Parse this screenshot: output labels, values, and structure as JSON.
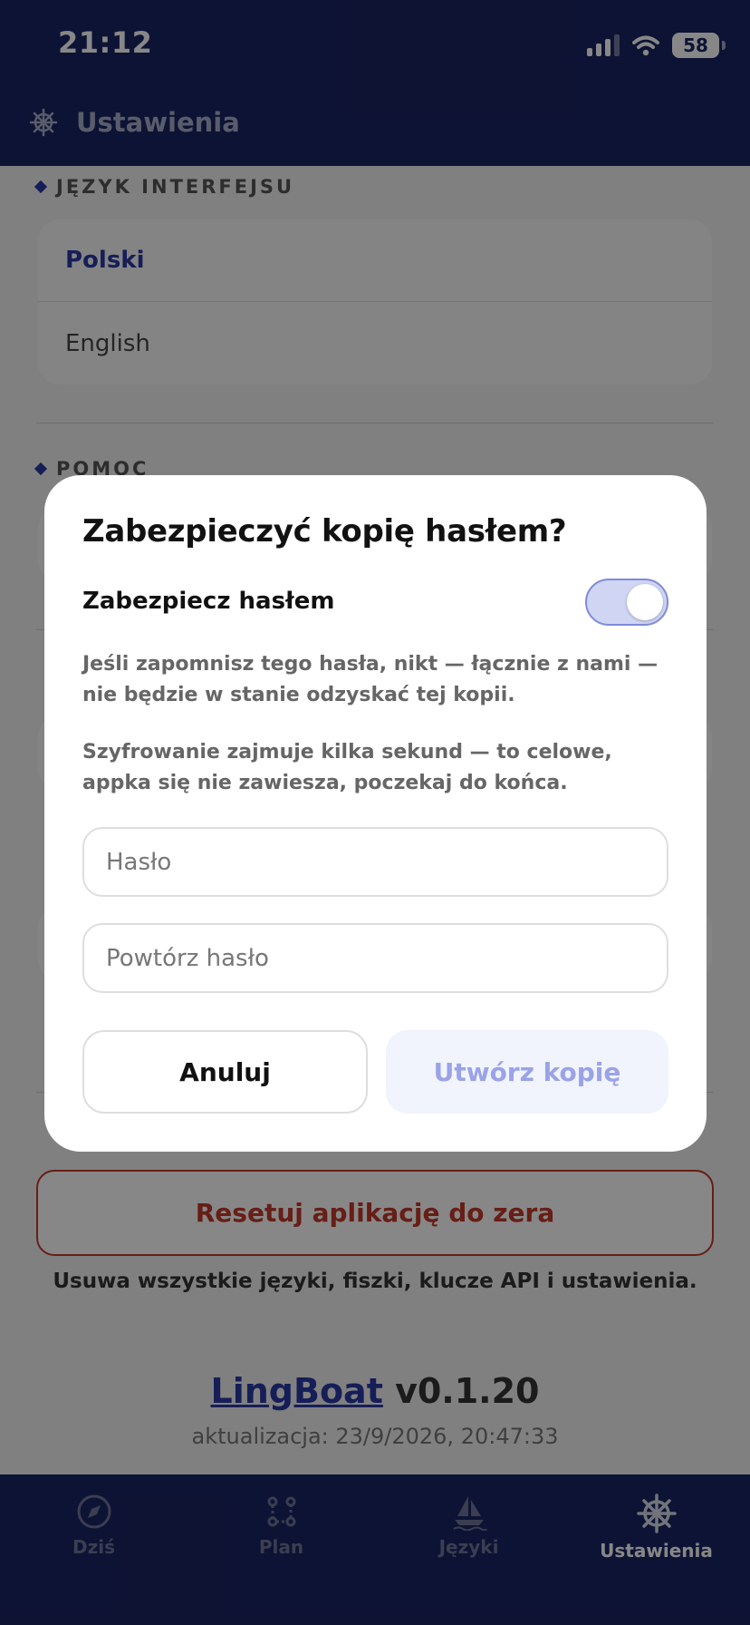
{
  "status_bar": {
    "time": "21:12",
    "battery": "58"
  },
  "header": {
    "title": "Ustawienia"
  },
  "background": {
    "interface_language_label": "JĘZYK INTERFEJSU",
    "languages": [
      "Polski",
      "English"
    ],
    "help_label": "POMOC",
    "reset_button": "Resetuj aplikację do zera",
    "reset_note": "Usuwa wszystkie języki, fiszki, klucze API i ustawienia.",
    "brand_name": "LingBoat",
    "version": "v0.1.20",
    "update_text": "aktualizacja: 23/9/2026, 20:47:33"
  },
  "tabs": [
    {
      "label": "Dziś",
      "icon": "compass-icon",
      "active": false
    },
    {
      "label": "Plan",
      "icon": "route-icon",
      "active": false
    },
    {
      "label": "Języki",
      "icon": "sailboat-icon",
      "active": false
    },
    {
      "label": "Ustawienia",
      "icon": "ship-wheel-icon",
      "active": true
    }
  ],
  "dialog": {
    "title": "Zabezpieczyć kopię hasłem?",
    "toggle_label": "Zabezpiecz hasłem",
    "toggle_on": true,
    "info_1": "Jeśli zapomnisz tego hasła, nikt — łącznie z nami — nie będzie w stanie odzyskać tej kopii.",
    "info_2": "Szyfrowanie zajmuje kilka sekund — to celowe, appka się nie zawiesza, poczekaj do końca.",
    "password_placeholder": "Hasło",
    "password_value": "",
    "repeat_placeholder": "Powtórz hasło",
    "repeat_value": "",
    "cancel_label": "Anuluj",
    "create_label": "Utwórz kopię"
  },
  "colors": {
    "primary": "#1a2463",
    "accent": "#2b3aa6",
    "danger": "#c0392b"
  }
}
